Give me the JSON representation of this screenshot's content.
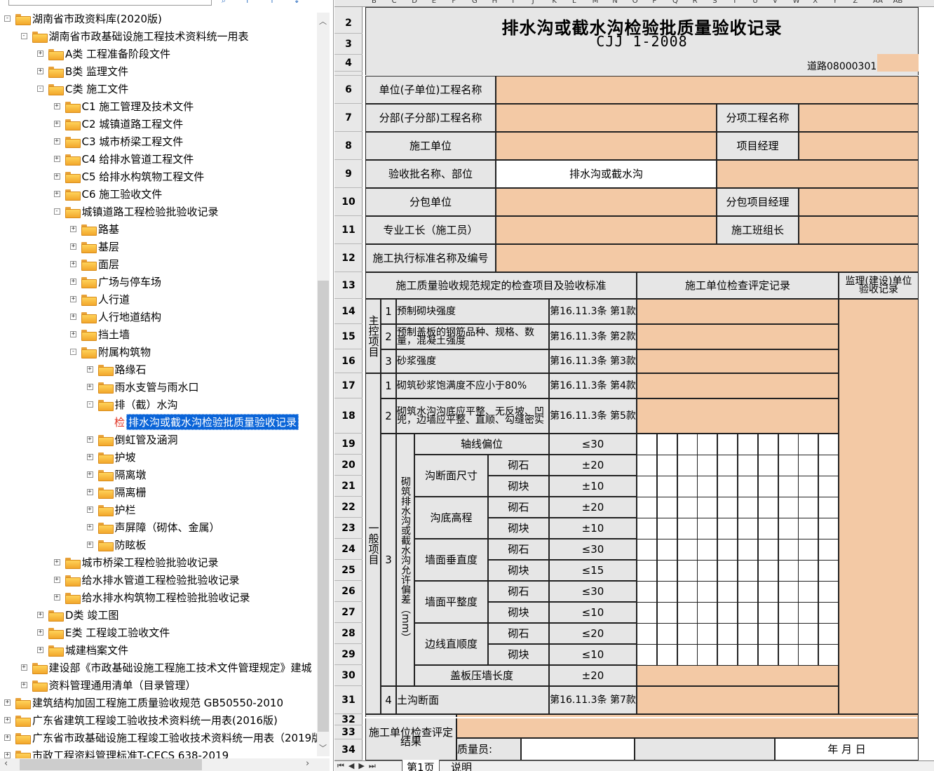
{
  "tree": {
    "nodes": [
      {
        "label": "湖南省市政资料库(2020版)",
        "level": 0,
        "expanded": true,
        "type": "folder"
      },
      {
        "label": "湖南省市政基础设施工程技术资料统一用表",
        "level": 1,
        "expanded": true,
        "type": "folder"
      },
      {
        "label": "A类 工程准备阶段文件",
        "level": 2,
        "expanded": false,
        "type": "folder"
      },
      {
        "label": "B类 监理文件",
        "level": 2,
        "expanded": false,
        "type": "folder"
      },
      {
        "label": "C类 施工文件",
        "level": 2,
        "expanded": true,
        "type": "folder"
      },
      {
        "label": "C1 施工管理及技术文件",
        "level": 3,
        "expanded": false,
        "type": "folder"
      },
      {
        "label": "C2 城镇道路工程文件",
        "level": 3,
        "expanded": false,
        "type": "folder"
      },
      {
        "label": "C3 城市桥梁工程文件",
        "level": 3,
        "expanded": false,
        "type": "folder"
      },
      {
        "label": "C4 给排水管道工程文件",
        "level": 3,
        "expanded": false,
        "type": "folder"
      },
      {
        "label": "C5 给排水构筑物工程文件",
        "level": 3,
        "expanded": false,
        "type": "folder"
      },
      {
        "label": "C6 施工验收文件",
        "level": 3,
        "expanded": false,
        "type": "folder"
      },
      {
        "label": "城镇道路工程检验批验收记录",
        "level": 3,
        "expanded": true,
        "type": "folder"
      },
      {
        "label": "路基",
        "level": 4,
        "expanded": false,
        "type": "folder"
      },
      {
        "label": "基层",
        "level": 4,
        "expanded": false,
        "type": "folder"
      },
      {
        "label": "面层",
        "level": 4,
        "expanded": false,
        "type": "folder"
      },
      {
        "label": "广场与停车场",
        "level": 4,
        "expanded": false,
        "type": "folder"
      },
      {
        "label": "人行道",
        "level": 4,
        "expanded": false,
        "type": "folder"
      },
      {
        "label": "人行地道结构",
        "level": 4,
        "expanded": false,
        "type": "folder"
      },
      {
        "label": "挡土墙",
        "level": 4,
        "expanded": false,
        "type": "folder"
      },
      {
        "label": "附属构筑物",
        "level": 4,
        "expanded": true,
        "type": "folder"
      },
      {
        "label": "路缘石",
        "level": 5,
        "expanded": false,
        "type": "folder"
      },
      {
        "label": "雨水支管与雨水口",
        "level": 5,
        "expanded": false,
        "type": "folder"
      },
      {
        "label": "排（截）水沟",
        "level": 5,
        "expanded": true,
        "type": "folder"
      },
      {
        "label": "排水沟或截水沟检验批质量验收记录",
        "level": 6,
        "type": "leaf",
        "leaf_mark": "检",
        "selected": true
      },
      {
        "label": "倒虹管及涵洞",
        "level": 5,
        "expanded": false,
        "type": "folder"
      },
      {
        "label": "护坡",
        "level": 5,
        "expanded": false,
        "type": "folder"
      },
      {
        "label": "隔离墩",
        "level": 5,
        "expanded": false,
        "type": "folder"
      },
      {
        "label": "隔离栅",
        "level": 5,
        "expanded": false,
        "type": "folder"
      },
      {
        "label": "护栏",
        "level": 5,
        "expanded": false,
        "type": "folder"
      },
      {
        "label": "声屏障（砌体、金属）",
        "level": 5,
        "expanded": false,
        "type": "folder"
      },
      {
        "label": "防眩板",
        "level": 5,
        "expanded": false,
        "type": "folder"
      },
      {
        "label": "城市桥梁工程检验批验收记录",
        "level": 3,
        "expanded": false,
        "type": "folder"
      },
      {
        "label": "给水排水管道工程检验批验收记录",
        "level": 3,
        "expanded": false,
        "type": "folder"
      },
      {
        "label": "给水排水构筑物工程检验批验收记录",
        "level": 3,
        "expanded": false,
        "type": "folder"
      },
      {
        "label": "D类 竣工图",
        "level": 2,
        "expanded": false,
        "type": "folder"
      },
      {
        "label": "E类 工程竣工验收文件",
        "level": 2,
        "expanded": false,
        "type": "folder"
      },
      {
        "label": "城建档案文件",
        "level": 2,
        "expanded": false,
        "type": "folder"
      },
      {
        "label": "建设部《市政基础设施工程施工技术文件管理规定》建城",
        "level": 1,
        "expanded": false,
        "type": "folder"
      },
      {
        "label": "资料管理通用清单（目录管理）",
        "level": 1,
        "expanded": false,
        "type": "folder"
      },
      {
        "label": "建筑结构加固工程施工质量验收规范 GB50550-2010",
        "level": 0,
        "expanded": false,
        "type": "folder"
      },
      {
        "label": "广东省建筑工程竣工验收技术资料统一用表(2016版)",
        "level": 0,
        "expanded": false,
        "type": "folder"
      },
      {
        "label": "广东省市政基础设施工程竣工验收技术资料统一用表（2019版",
        "level": 0,
        "expanded": false,
        "type": "folder"
      },
      {
        "label": "市政工程资料管理标准T-CECS 638-2019",
        "level": 0,
        "expanded": false,
        "type": "folder"
      }
    ]
  },
  "columns": [
    "B",
    "C",
    "D",
    "E",
    "F",
    "G",
    "H",
    "I",
    "J",
    "K",
    "L",
    "M",
    "N",
    "O",
    "P",
    "Q",
    "R",
    "S",
    "T",
    "U",
    "V",
    "W",
    "X",
    "Y",
    "Z",
    "AA",
    "AB"
  ],
  "rows": [
    "2",
    "3",
    "4",
    "",
    "6",
    "7",
    "8",
    "9",
    "10",
    "11",
    "12",
    "13",
    "14",
    "15",
    "16",
    "17",
    "18",
    "19",
    "20",
    "21",
    "22",
    "23",
    "24",
    "25",
    "26",
    "27",
    "28",
    "29",
    "30",
    "31",
    "32",
    "33",
    "34"
  ],
  "form": {
    "title": "排水沟或截水沟检验批质量验收记录",
    "standard": "CJJ 1-2008",
    "code": "道路08000301",
    "unit_project_label": "单位(子单位)工程名称",
    "division_label": "分部(子分部)工程名称",
    "subitem_label": "分项工程名称",
    "contractor_label": "施工单位",
    "pm_label": "项目经理",
    "batch_label": "验收批名称、部位",
    "batch_value": "排水沟或截水沟",
    "subcontractor_label": "分包单位",
    "sub_pm_label": "分包项目经理",
    "foreman_label": "专业工长（施工员）",
    "team_leader_label": "施工班组长",
    "exec_std_label": "施工执行标准名称及编号",
    "col_items": "施工质量验收规范规定的检查项目及验收标准",
    "col_contractor": "施工单位检查评定记录",
    "col_supervisor": "监理(建设)单位验收记录",
    "main_items_label": "主控项目",
    "general_items_label": "一般项目",
    "main_items": [
      {
        "no": "1",
        "text": "预制砌块强度",
        "ref": "第16.11.3条 第1款"
      },
      {
        "no": "2",
        "text": "预制盖板的钢筋品种、规格、数量，混凝土强度",
        "ref": "第16.11.3条 第2款"
      },
      {
        "no": "3",
        "text": "砂浆强度",
        "ref": "第16.11.3条 第3款"
      }
    ],
    "general_items": [
      {
        "no": "1",
        "text": "砌筑砂浆饱满度不应小于80%",
        "ref": "第16.11.3条 第4款"
      },
      {
        "no": "2",
        "text": "砌筑水沟沟底应平整、无反坡、凹兜，边墙应平整、直顺、勾缝密实",
        "ref": "第16.11.3条 第5款"
      }
    ],
    "item3_no": "3",
    "item3_label": "砌筑排水沟或截水沟允许偏差（mm）",
    "deviation": [
      {
        "group": "轴线偏位",
        "sub": "",
        "value": "≤30"
      },
      {
        "group": "沟断面尺寸",
        "sub": "砌石",
        "value": "±20"
      },
      {
        "group": "",
        "sub": "砌块",
        "value": "±10"
      },
      {
        "group": "沟底高程",
        "sub": "砌石",
        "value": "±20"
      },
      {
        "group": "",
        "sub": "砌块",
        "value": "±10"
      },
      {
        "group": "墙面垂直度",
        "sub": "砌石",
        "value": "≤30"
      },
      {
        "group": "",
        "sub": "砌块",
        "value": "≤15"
      },
      {
        "group": "墙面平整度",
        "sub": "砌石",
        "value": "≤30"
      },
      {
        "group": "",
        "sub": "砌块",
        "value": "≤10"
      },
      {
        "group": "边线直顺度",
        "sub": "砌石",
        "value": "≤20"
      },
      {
        "group": "",
        "sub": "砌块",
        "value": "≤10"
      },
      {
        "group": "盖板压墙长度",
        "sub": "",
        "value": "±20"
      }
    ],
    "item4_no": "4",
    "item4_text": "土沟断面",
    "item4_ref": "第16.11.3条 第7款",
    "eval_label": "施工单位检查评定结果",
    "inspector_label": "质量员:",
    "date_label": "年 月 日"
  },
  "sheet_tabs": [
    "第1页",
    "说明"
  ],
  "colors": {
    "orange": "#f3c9a5",
    "gray": "#e6e6e6",
    "selection": "#0a64d8"
  }
}
